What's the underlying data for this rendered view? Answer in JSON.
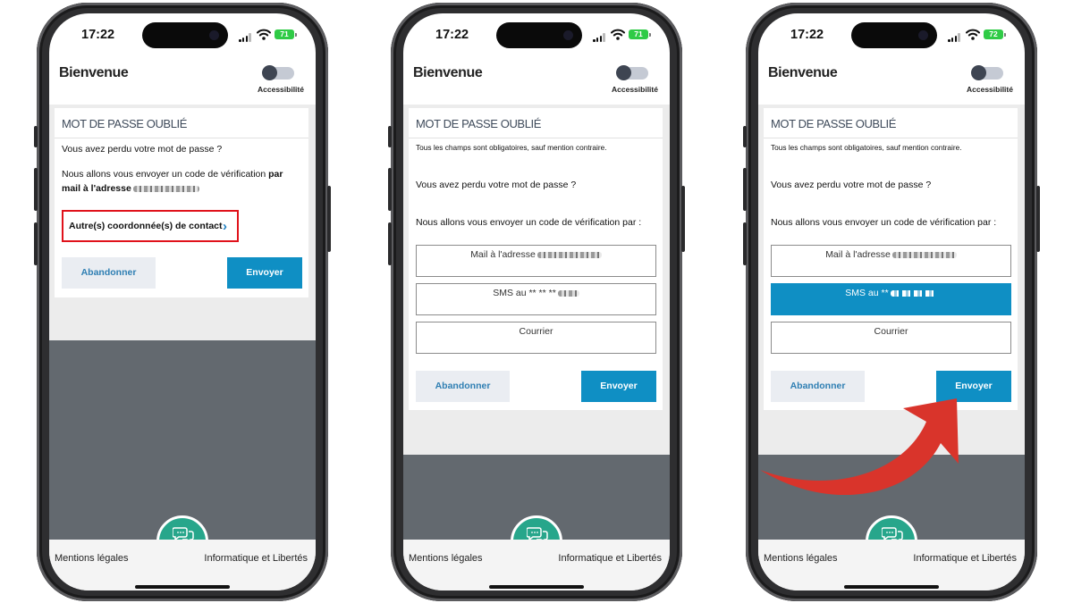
{
  "status": {
    "time": "17:22"
  },
  "header": {
    "title": "Bienvenue",
    "accessibility_label": "Accessibilité"
  },
  "card": {
    "title": "MOT DE PASSE OUBLIÉ",
    "required_note": "Tous les champs sont obligatoires, sauf mention contraire.",
    "question": "Vous avez perdu votre mot de passe ?",
    "send_intro": "Nous allons vous envoyer un code de vérification ",
    "send_intro_bold": "par mail à l'adresse",
    "send_intro_par": "Nous allons vous envoyer un code de vérification par :"
  },
  "phones": [
    {
      "battery": "71",
      "other_contact_label": "Autre(s) coordonnée(s) de contact"
    },
    {
      "battery": "71",
      "options": [
        {
          "label": "Mail à l'adresse"
        },
        {
          "label": "SMS au ** ** **"
        },
        {
          "label": "Courrier"
        }
      ]
    },
    {
      "battery": "72",
      "options": [
        {
          "label": "Mail à l'adresse"
        },
        {
          "label": "SMS au **"
        },
        {
          "label": "Courrier"
        }
      ],
      "selected_option": "SMS"
    }
  ],
  "buttons": {
    "cancel": "Abandonner",
    "send": "Envoyer"
  },
  "footer": {
    "legal": "Mentions légales",
    "privacy": "Informatique et Libertés"
  },
  "colors": {
    "accent": "#0f8fc4",
    "chat": "#27a68b",
    "highlight": "#e0121b",
    "arrow": "#d9342b"
  },
  "icons": {
    "chat": "chat-bubbles-icon",
    "chevron": "chevron-right-icon",
    "signal": "signal-icon",
    "wifi": "wifi-icon",
    "battery": "battery-icon"
  }
}
